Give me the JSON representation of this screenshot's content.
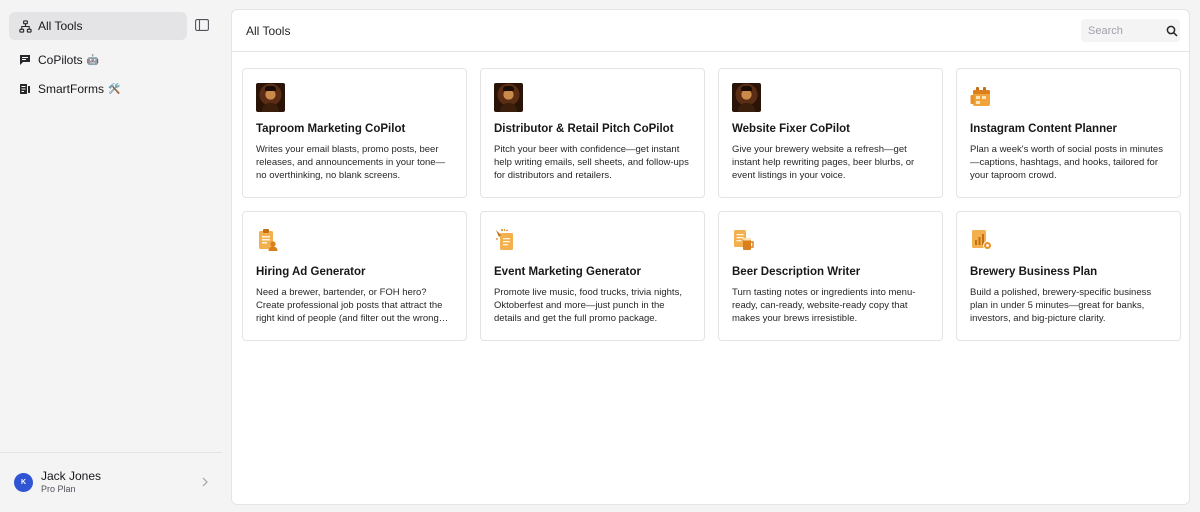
{
  "sidebar": {
    "items": [
      {
        "label": "All Tools",
        "emoji": "",
        "icon": "sitemap-icon",
        "active": true
      },
      {
        "label": "CoPilots",
        "emoji": "🤖",
        "icon": "chat-icon",
        "active": false
      },
      {
        "label": "SmartForms",
        "emoji": "🛠️",
        "icon": "form-icon",
        "active": false
      }
    ],
    "toggle_icon": "sidebar-toggle-icon",
    "user": {
      "initial": "K",
      "name": "Jack Jones",
      "plan": "Pro Plan"
    }
  },
  "header": {
    "title": "All Tools",
    "search_placeholder": "Search"
  },
  "colors": {
    "accent_orange": "#e8922a",
    "avatar_blue": "#2f55d4"
  },
  "tools": [
    {
      "icon": "portrait-icon",
      "title": "Taproom Marketing CoPilot",
      "description": "Writes your email blasts, promo posts, beer releases, and announcements in your tone—no overthinking, no blank screens."
    },
    {
      "icon": "portrait-icon",
      "title": "Distributor & Retail Pitch CoPilot",
      "description": "Pitch your beer with confidence—get instant help writing emails, sell sheets, and follow-ups for distributors and retailers."
    },
    {
      "icon": "portrait-icon",
      "title": "Website Fixer CoPilot",
      "description": "Give your brewery website a refresh—get instant help rewriting pages, beer blurbs, or event listings in your voice."
    },
    {
      "icon": "calendar-icon",
      "title": "Instagram Content Planner",
      "description": "Plan a week's worth of social posts in minutes—captions, hashtags, and hooks, tailored for your taproom crowd."
    },
    {
      "icon": "clipboard-user-icon",
      "title": "Hiring Ad Generator",
      "description": "Need a brewer, bartender, or FOH hero? Create professional job posts that attract the right kind of people (and filter out the wrong ones)."
    },
    {
      "icon": "party-document-icon",
      "title": "Event Marketing Generator",
      "description": "Promote live music, food trucks, trivia nights, Oktoberfest and more—just punch in the details and get the full promo package."
    },
    {
      "icon": "beer-document-icon",
      "title": "Beer Description Writer",
      "description": "Turn tasting notes or ingredients into menu-ready, can-ready, website-ready copy that makes your brews irresistible."
    },
    {
      "icon": "business-plan-icon",
      "title": "Brewery Business Plan",
      "description": "Build a polished, brewery-specific business plan in under 5 minutes—great for banks, investors, and big-picture clarity."
    }
  ]
}
